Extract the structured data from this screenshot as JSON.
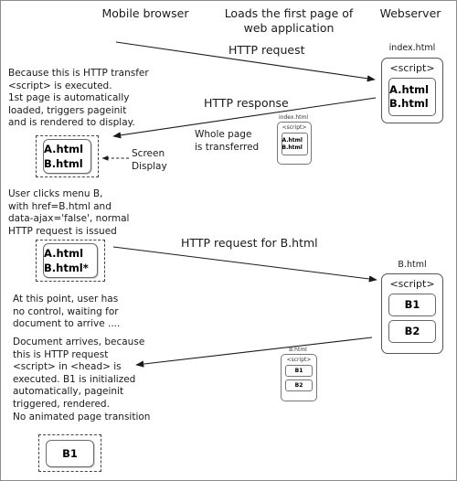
{
  "headers": {
    "mobile_browser": "Mobile browser",
    "loads_first_page": "Loads the first page of\nweb application",
    "webserver": "Webserver"
  },
  "arrow_labels": {
    "http_request": "HTTP request",
    "http_response": "HTTP response",
    "http_request_b": "HTTP request for B.html"
  },
  "notes": {
    "because_http": "Because this is HTTP transfer\n<script> is executed.\n1st page is automatically\nloaded, triggers pageinit\nand is rendered to display.",
    "whole_page": "Whole page\nis transferred",
    "screen_display": "Screen\nDisplay",
    "user_clicks": "User clicks menu B,\nwith href=B.html and\ndata-ajax='false', normal\nHTTP request is issued",
    "no_control": "At this point, user has\nno control, waiting for\ndocument to arrive ....",
    "document_arrives": "Document arrives, because\nthis is HTTP request\n<script> in <head> is\nexecuted. B1 is initialized\nautomatically, pageinit\ntriggered, rendered.\nNo animated page transition"
  },
  "server_index_doc": {
    "caption": "index.html",
    "script_tag": "<script>",
    "files": "A.html\nB.html"
  },
  "transferred_index_doc": {
    "caption": "index.html",
    "script_tag": "<script>",
    "files": "A.html\nB.html"
  },
  "server_b_doc": {
    "caption": "B.html",
    "script_tag": "<script>",
    "page1": "B1",
    "page2": "B2"
  },
  "transferred_b_doc": {
    "caption": "B.html",
    "script_tag": "<script>",
    "page1": "B1",
    "page2": "B2"
  },
  "screen_1": {
    "content": "A.html\nB.html"
  },
  "screen_2": {
    "content": "A.html\nB.html*"
  },
  "screen_3": {
    "content": "B1"
  },
  "colors": {
    "ink": "#1a1a1a",
    "box_border": "#555555",
    "dashed_border": "#444444",
    "frame": "#8c8c8c"
  }
}
